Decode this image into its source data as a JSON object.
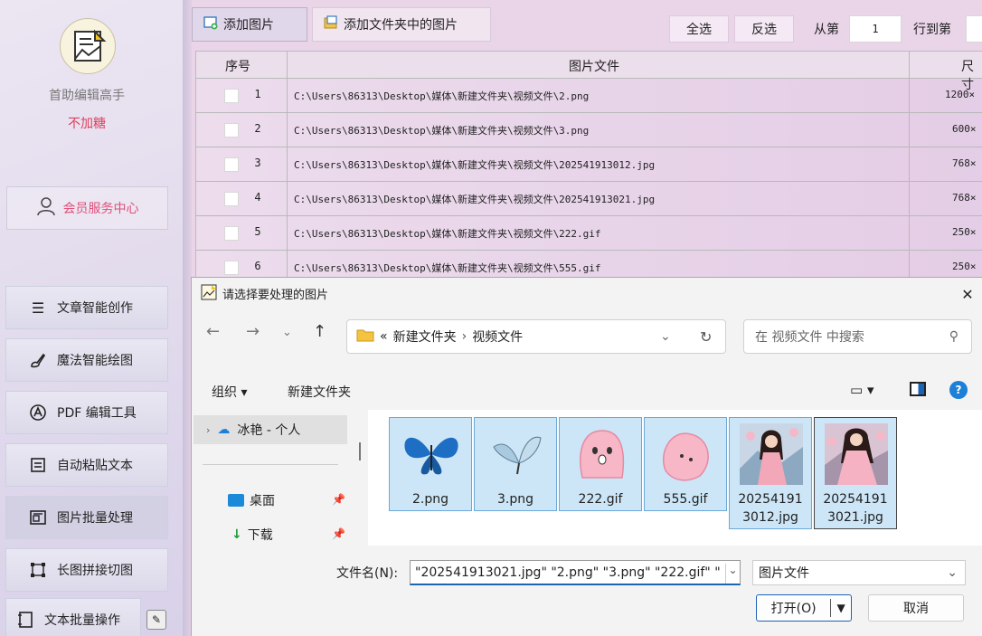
{
  "sidebar": {
    "app_title": "首助编辑高手",
    "app_subtitle": "不加糖",
    "member_label": "会员服务中心",
    "items": [
      {
        "label": "文章智能创作"
      },
      {
        "label": "魔法智能绘图"
      },
      {
        "label": "PDF 编辑工具"
      },
      {
        "label": "自动粘贴文本"
      },
      {
        "label": "图片批量处理"
      },
      {
        "label": "长图拼接切图"
      },
      {
        "label": "文本批量操作"
      }
    ]
  },
  "toolbar": {
    "add_image": "添加图片",
    "add_folder_images": "添加文件夹中的图片",
    "select_all": "全选",
    "invert_select": "反选",
    "from_label": "从第",
    "from_value": "1",
    "to_label": "行到第"
  },
  "table": {
    "headers": [
      "序号",
      "图片文件",
      "尺寸"
    ],
    "rows": [
      {
        "num": "1",
        "path": "C:\\Users\\86313\\Desktop\\媒体\\新建文件夹\\视频文件\\2.png",
        "size": "1200×"
      },
      {
        "num": "2",
        "path": "C:\\Users\\86313\\Desktop\\媒体\\新建文件夹\\视频文件\\3.png",
        "size": "600×"
      },
      {
        "num": "3",
        "path": "C:\\Users\\86313\\Desktop\\媒体\\新建文件夹\\视频文件\\202541913012.jpg",
        "size": "768×"
      },
      {
        "num": "4",
        "path": "C:\\Users\\86313\\Desktop\\媒体\\新建文件夹\\视频文件\\202541913021.jpg",
        "size": "768×"
      },
      {
        "num": "5",
        "path": "C:\\Users\\86313\\Desktop\\媒体\\新建文件夹\\视频文件\\222.gif",
        "size": "250×"
      },
      {
        "num": "6",
        "path": "C:\\Users\\86313\\Desktop\\媒体\\新建文件夹\\视频文件\\555.gif",
        "size": "250×"
      }
    ]
  },
  "dialog": {
    "title": "请选择要处理的图片",
    "breadcrumb_prefix": "«",
    "breadcrumb_1": "新建文件夹",
    "breadcrumb_2": "视频文件",
    "search_placeholder": "在 视频文件 中搜索",
    "organize": "组织 ▾",
    "new_folder": "新建文件夹",
    "nav_items": [
      {
        "label": "冰艳 - 个人"
      },
      {
        "label": "桌面"
      },
      {
        "label": "下载"
      }
    ],
    "files": [
      {
        "name": "2.png"
      },
      {
        "name": "3.png"
      },
      {
        "name": "222.gif"
      },
      {
        "name": "555.gif"
      },
      {
        "name_line1": "20254191",
        "name_line2": "3012.jpg"
      },
      {
        "name_line1": "20254191",
        "name_line2": "3021.jpg"
      }
    ],
    "filename_label": "文件名(N):",
    "filename_value": "\"202541913021.jpg\" \"2.png\" \"3.png\" \"222.gif\" \"",
    "filetype": "图片文件",
    "open_label": "打开(O)",
    "cancel_label": "取消"
  }
}
